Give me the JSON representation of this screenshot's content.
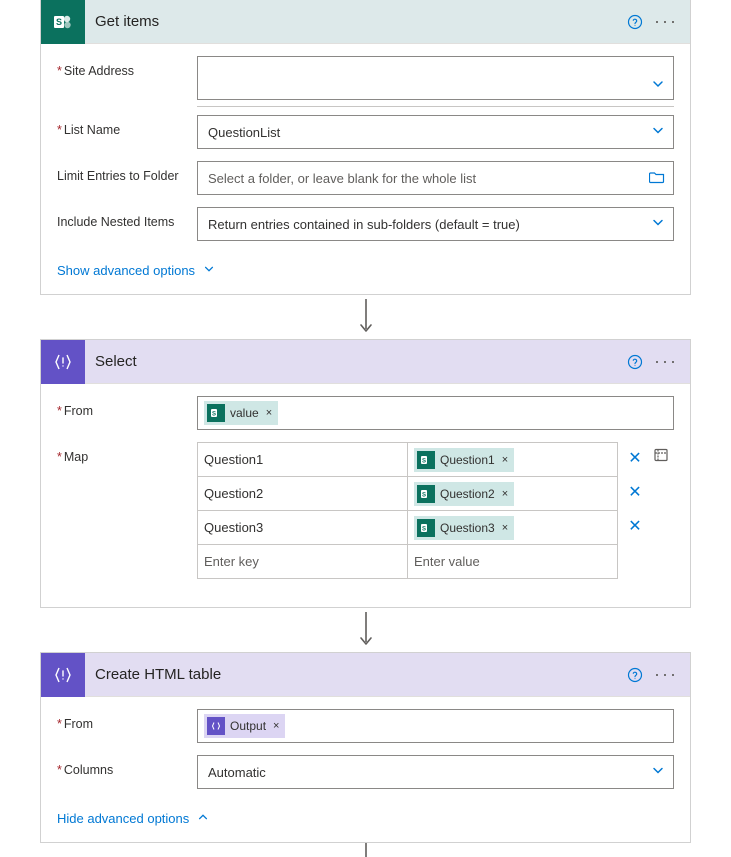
{
  "colors": {
    "sharepoint": "#0b715e",
    "dataop": "#6352c6",
    "link": "#0078d4"
  },
  "actions": {
    "get_items": {
      "title": "Get items",
      "fields": {
        "site_address": {
          "label": "Site Address",
          "value": ""
        },
        "list_name": {
          "label": "List Name",
          "value": "QuestionList"
        },
        "limit_folder": {
          "label": "Limit Entries to Folder",
          "placeholder": "Select a folder, or leave blank for the whole list",
          "value": ""
        },
        "include_nested": {
          "label": "Include Nested Items",
          "value": "Return entries contained in sub-folders (default = true)"
        }
      },
      "advanced_label": "Show advanced options"
    },
    "select": {
      "title": "Select",
      "from": {
        "label": "From",
        "token": "value"
      },
      "map_label": "Map",
      "map_rows": [
        {
          "key": "Question1",
          "value_token": "Question1"
        },
        {
          "key": "Question2",
          "value_token": "Question2"
        },
        {
          "key": "Question3",
          "value_token": "Question3"
        }
      ],
      "map_placeholder_key": "Enter key",
      "map_placeholder_value": "Enter value"
    },
    "create_html": {
      "title": "Create HTML table",
      "from": {
        "label": "From",
        "token": "Output"
      },
      "columns": {
        "label": "Columns",
        "value": "Automatic"
      },
      "advanced_label": "Hide advanced options"
    }
  }
}
